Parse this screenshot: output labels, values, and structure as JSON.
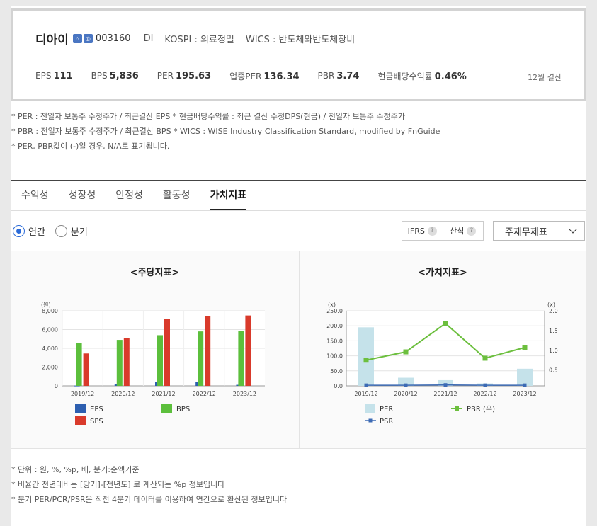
{
  "company": {
    "name": "디아이",
    "code": "003160",
    "abbr": "DI",
    "market": "KOSPI : 의료정밀",
    "wics": "WICS : 반도체와반도체장비",
    "fiscal": "12월 결산"
  },
  "metrics": [
    {
      "label": "EPS",
      "value": "111"
    },
    {
      "label": "BPS",
      "value": "5,836"
    },
    {
      "label": "PER",
      "value": "195.63"
    },
    {
      "label": "업종PER",
      "value": "136.34"
    },
    {
      "label": "PBR",
      "value": "3.74"
    },
    {
      "label": "현금배당수익률",
      "value": "0.46%"
    }
  ],
  "notes_top": [
    "* PER : 전일자 보통주 수정주가 / 최근결산 EPS * 현금배당수익률 : 최근 결산 수정DPS(현금) / 전일자 보통주 수정주가",
    "* PBR : 전일자 보통주 수정주가 / 최근결산 BPS * WICS : WISE Industry Classification Standard, modified by FnGuide",
    "* PER, PBR값이 (-)일 경우, N/A로 표기됩니다."
  ],
  "tabs": [
    "수익성",
    "성장성",
    "안정성",
    "활동성",
    "가치지표"
  ],
  "active_tab": "가치지표",
  "period": {
    "annual": "연간",
    "quarter": "분기",
    "selected": "연간"
  },
  "buttons": {
    "ifrs": "IFRS",
    "calc": "산식",
    "help": "?"
  },
  "select": {
    "value": "주재무제표"
  },
  "colors": {
    "eps": "#2d5fb0",
    "bps": "#5cbf3c",
    "sps": "#d93a2b",
    "per": "#c5e2ea",
    "pbr": "#6cbf3e",
    "psr": "#3c6ab4"
  },
  "chart_data": [
    {
      "type": "bar",
      "title": "<주당지표>",
      "ylabel": "(원)",
      "categories": [
        "2019/12",
        "2020/12",
        "2021/12",
        "2022/12",
        "2023/12"
      ],
      "ylim": [
        0,
        8000
      ],
      "yticks": [
        "0",
        "2,000",
        "4,000",
        "6,000",
        "8,000"
      ],
      "series": [
        {
          "name": "EPS",
          "values": [
            30,
            150,
            450,
            440,
            110
          ]
        },
        {
          "name": "BPS",
          "values": [
            4600,
            4900,
            5400,
            5800,
            5836
          ]
        },
        {
          "name": "SPS",
          "values": [
            3450,
            5100,
            7100,
            7400,
            7500
          ]
        }
      ],
      "legend": "bottom"
    },
    {
      "type": "bar",
      "title": "<가치지표>",
      "ylabel": "(x)",
      "y2label": "(x)",
      "categories": [
        "2019/12",
        "2020/12",
        "2021/12",
        "2022/12",
        "2023/12"
      ],
      "ylim": [
        0,
        250
      ],
      "y2lim": [
        0.1,
        2.0
      ],
      "yticks": [
        "0.0",
        "50.0",
        "100.0",
        "150.0",
        "200.0",
        "250.0"
      ],
      "y2ticks": [
        "0.5",
        "1.0",
        "1.5",
        "2.0"
      ],
      "series": [
        {
          "name": "PER",
          "type": "bar",
          "axis": "left",
          "values": [
            195,
            27,
            19,
            8,
            57
          ]
        },
        {
          "name": "PBR (우)",
          "type": "line",
          "axis": "right",
          "values": [
            0.75,
            0.96,
            1.68,
            0.8,
            1.07
          ]
        },
        {
          "name": "PSR",
          "type": "line",
          "axis": "left",
          "values": [
            2,
            2,
            3,
            2,
            2
          ]
        }
      ],
      "legend": "bottom"
    }
  ],
  "notes_bottom": [
    "* 단위 : 원, %, %p, 배, 분기:순액기준",
    "* 비율간 전년대비는 [당기]-[전년도] 로 계산되는 %p 정보입니다",
    "* 분기 PER/PCR/PSR은 직전 4분기 데이터를 이용하여 연간으로 환산된 정보입니다"
  ]
}
